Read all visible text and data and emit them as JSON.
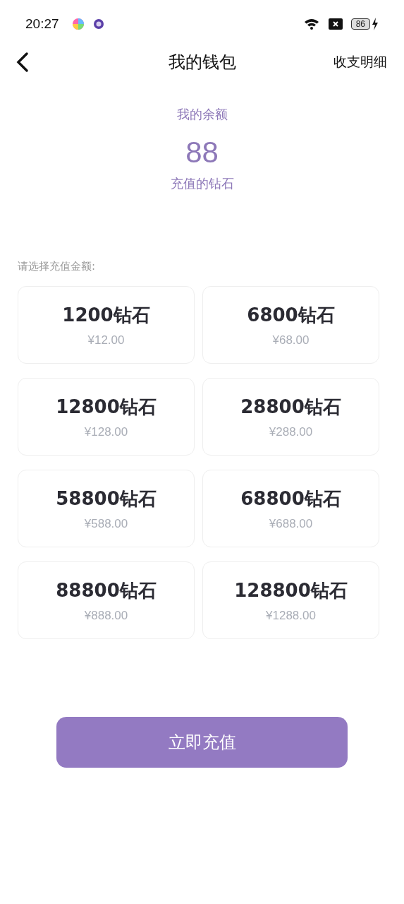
{
  "status_bar": {
    "time": "20:27",
    "battery": "86"
  },
  "header": {
    "title": "我的钱包",
    "action": "收支明细"
  },
  "balance": {
    "label": "我的余额",
    "amount": "88",
    "unit": "充值的钻石"
  },
  "prompt": "请选择充值金额:",
  "packages": [
    {
      "diamonds": "1200钻石",
      "price": "¥12.00",
      "selected": false
    },
    {
      "diamonds": "6800钻石",
      "price": "¥68.00",
      "selected": false
    },
    {
      "diamonds": "12800钻石",
      "price": "¥128.00",
      "selected": false
    },
    {
      "diamonds": "28800钻石",
      "price": "¥288.00",
      "selected": false
    },
    {
      "diamonds": "58800钻石",
      "price": "¥588.00",
      "selected": false
    },
    {
      "diamonds": "68800钻石",
      "price": "¥688.00",
      "selected": false
    },
    {
      "diamonds": "88800钻石",
      "price": "¥888.00",
      "selected": false
    },
    {
      "diamonds": "128800钻石",
      "price": "¥1288.00",
      "selected": false
    }
  ],
  "submit": "立即充值"
}
